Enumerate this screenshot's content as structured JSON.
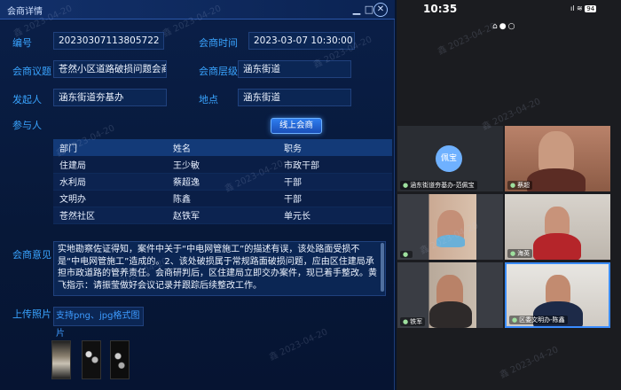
{
  "window": {
    "title": "会商详情",
    "minimize": "▁",
    "maximize": "□",
    "close": "✕"
  },
  "form": {
    "number_label": "编号",
    "number_value": "20230307113805722",
    "time_label": "会商时间",
    "time_value": "2023-03-07 10:30:00",
    "topic_label": "会商议题",
    "topic_value": "苍然小区道路破损问题会商",
    "level_label": "会商层级",
    "level_value": "涵东街道",
    "initiator_label": "发起人",
    "initiator_value": "涵东街道夯基办",
    "place_label": "地点",
    "place_value": "涵东街道",
    "participants_label": "参与人",
    "online_button": "线上会商"
  },
  "attendees": {
    "headers": [
      "部门",
      "姓名",
      "职务"
    ],
    "rows": [
      [
        "住建局",
        "王少敏",
        "市政干部"
      ],
      [
        "水利局",
        "蔡超逸",
        "干部"
      ],
      [
        "文明办",
        "陈鑫",
        "干部"
      ],
      [
        "苍然社区",
        "赵铁军",
        "单元长"
      ]
    ]
  },
  "opinion": {
    "label": "会商意见",
    "text": "实地勘察佐证得知，案件中关于“中电网管施工”的描述有误，该处路面受损不是“中电网管施工”造成的。2、该处破损属于常规路面破损问题，应由区住建局承担市政道路的管养责任。会商研判后，区住建局立即交办案件，现已着手整改。黄飞指示：请振莹做好会议记录并跟踪后续整改工作。"
  },
  "upload": {
    "label": "上传照片",
    "hint": "支持png、jpg格式图片"
  },
  "phone": {
    "time": "10:35",
    "battery": "94",
    "signal": "ıl",
    "wifi": "≋",
    "tiles": [
      {
        "name": "涵东街道夯基办-范佩宝",
        "avatar_text": "佩宝"
      },
      {
        "name": "蔡超"
      },
      {
        "name": ""
      },
      {
        "name": "海英"
      },
      {
        "name": "铁军"
      },
      {
        "name": "区委文明办-陈鑫"
      }
    ]
  },
  "watermark": "鑫 2023-04-20",
  "colors": {
    "accent": "#39a4ff",
    "panel": "#0a1f48",
    "active_tile": "#3a8cff"
  }
}
